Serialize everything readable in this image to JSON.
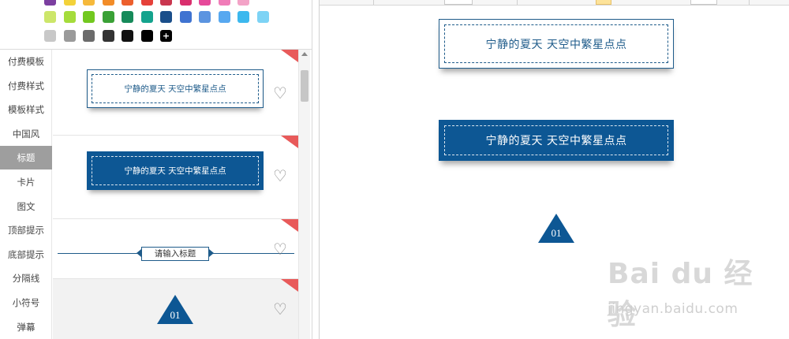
{
  "palette": {
    "rows": [
      [
        "#7b3fa0",
        "#f3d23a",
        "#f6b93b",
        "#f28c28",
        "#ec5f2d",
        "#e5413a",
        "#c9364f",
        "#d92f6d",
        "#e6499a",
        "#f07cb8",
        "#f3a3c7"
      ],
      [
        "#cce66a",
        "#a5dc3b",
        "#72c81f",
        "#3aa136",
        "#168a5a",
        "#14a38d",
        "#1a4e8a",
        "#3f73d1",
        "#5b94e0",
        "#57a8f0",
        "#3cb8ee",
        "#7dd3f5"
      ],
      [
        "#c8c8c8",
        "#9a9a9a",
        "#6b6b6b",
        "#333333",
        "#111111",
        "#000000"
      ]
    ],
    "add_label": "+"
  },
  "categories": [
    {
      "label": "付费模板"
    },
    {
      "label": "付费样式"
    },
    {
      "label": "模板样式"
    },
    {
      "label": "中国风"
    },
    {
      "label": "标题",
      "active": true
    },
    {
      "label": "卡片"
    },
    {
      "label": "图文"
    },
    {
      "label": "顶部提示"
    },
    {
      "label": "底部提示"
    },
    {
      "label": "分隔线"
    },
    {
      "label": "小符号"
    },
    {
      "label": "弹幕"
    }
  ],
  "templates": {
    "t1_text": "宁静的夏天 天空中繁星点点",
    "t2_text": "宁静的夏天 天空中繁星点点",
    "t3_text": "请输入标题",
    "t4_text": "01",
    "heart_glyph": "♡"
  },
  "editor": {
    "title1": "宁静的夏天  天空中繁星点点",
    "title2": "宁静的夏天  天空中繁星点点",
    "number": "01"
  },
  "watermark": {
    "logo": "Bai du 经验",
    "url": "jingyan.baidu.com"
  },
  "colors": {
    "accent": "#0d5794",
    "corner_tag": "#e85a5a",
    "active_category": "#9e9e9e"
  }
}
